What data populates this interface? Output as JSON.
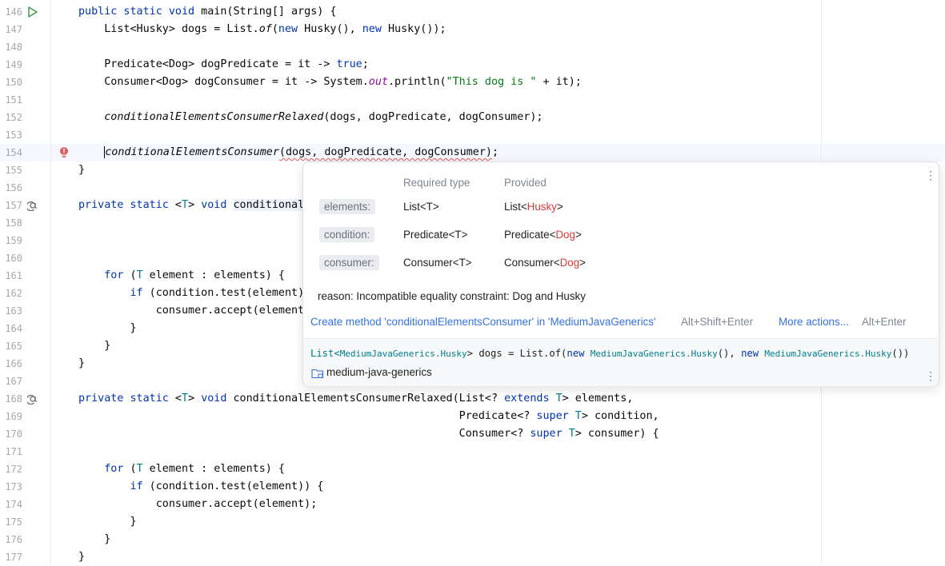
{
  "editor": {
    "lines": [
      {
        "n": "146",
        "html": "<span class=\"kw\">public static void</span> main(String[] args) {"
      },
      {
        "n": "147",
        "html": "    List&lt;Husky&gt; dogs = List.<span class=\"it\">of</span>(<span class=\"kw\">new</span> Husky(), <span class=\"kw\">new</span> Husky());"
      },
      {
        "n": "148",
        "html": ""
      },
      {
        "n": "149",
        "html": "    Predicate&lt;Dog&gt; dogPredicate = it -&gt; <span class=\"kw\">true</span>;"
      },
      {
        "n": "150",
        "html": "    Consumer&lt;Dog&gt; dogConsumer = it -&gt; System.<span class=\"it\" style=\"color:#871094\">out</span>.println(<span class=\"st\">\"This dog is \"</span> + it);"
      },
      {
        "n": "151",
        "html": ""
      },
      {
        "n": "152",
        "html": "    <span class=\"it\">conditionalElementsConsumerRelaxed</span>(dogs, dogPredicate, dogConsumer);"
      },
      {
        "n": "153",
        "html": ""
      },
      {
        "n": "154",
        "html": "    <span class=\"caret\"></span><span class=\"it\">conditionalElementsConsumer</span><span class=\"squig\">(dogs, dogPredicate, dogConsumer)</span>;"
      },
      {
        "n": "155",
        "html": "}"
      },
      {
        "n": "156",
        "html": ""
      },
      {
        "n": "157",
        "html": "<span class=\"kw\">private static</span> &lt;<span class=\"tp\">T</span>&gt; <span class=\"kw\">void</span> <span class=\"hl\">conditional</span>"
      },
      {
        "n": "158",
        "html": ""
      },
      {
        "n": "159",
        "html": ""
      },
      {
        "n": "160",
        "html": ""
      },
      {
        "n": "161",
        "html": "    <span class=\"kw\">for</span> (<span class=\"tp\">T</span> element : elements) {"
      },
      {
        "n": "162",
        "html": "        <span class=\"kw\">if</span> (condition.test(element)"
      },
      {
        "n": "163",
        "html": "            consumer.accept(element"
      },
      {
        "n": "164",
        "html": "        }"
      },
      {
        "n": "165",
        "html": "    }"
      },
      {
        "n": "166",
        "html": "}"
      },
      {
        "n": "167",
        "html": ""
      },
      {
        "n": "168",
        "html": "<span class=\"kw\">private static</span> &lt;<span class=\"tp\">T</span>&gt; <span class=\"kw\">void</span> conditionalElementsConsumerRelaxed(List&lt;? <span class=\"kw\">extends</span> <span class=\"tp\">T</span>&gt; elements,"
      },
      {
        "n": "169",
        "html": "                                                           Predicate&lt;? <span class=\"kw\">super</span> <span class=\"tp\">T</span>&gt; condition,"
      },
      {
        "n": "170",
        "html": "                                                           Consumer&lt;? <span class=\"kw\">super</span> <span class=\"tp\">T</span>&gt; consumer) {"
      },
      {
        "n": "171",
        "html": ""
      },
      {
        "n": "172",
        "html": "    <span class=\"kw\">for</span> (<span class=\"tp\">T</span> element : elements) {"
      },
      {
        "n": "173",
        "html": "        <span class=\"kw\">if</span> (condition.test(element)) {"
      },
      {
        "n": "174",
        "html": "            consumer.accept(element);"
      },
      {
        "n": "175",
        "html": "        }"
      },
      {
        "n": "176",
        "html": "    }"
      },
      {
        "n": "177",
        "html": "}"
      }
    ]
  },
  "popup": {
    "header_required": "Required type",
    "header_provided": "Provided",
    "rows": [
      {
        "param": "elements:",
        "required": "List<T>",
        "provided_prefix": "List<",
        "provided_type": "Husky",
        "provided_suffix": ">"
      },
      {
        "param": "condition:",
        "required": "Predicate<T>",
        "provided_prefix": "Predicate<",
        "provided_type": "Dog",
        "provided_suffix": ">"
      },
      {
        "param": "consumer:",
        "required": "Consumer<T>",
        "provided_prefix": "Consumer<",
        "provided_type": "Dog",
        "provided_suffix": ">"
      }
    ],
    "reason": "reason: Incompatible equality constraint: Dog and Husky",
    "action_create": "Create method 'conditionalElementsConsumer' in 'MediumJavaGenerics'",
    "action_create_shortcut": "Alt+Shift+Enter",
    "action_more": "More actions...",
    "action_more_shortcut": "Alt+Enter",
    "decl": {
      "p1": "List<",
      "c1": "MediumJavaGenerics.Husky",
      "p2": "> dogs = List.of(",
      "k1": "new",
      "c2": "MediumJavaGenerics.Husky",
      "p3": "(), ",
      "k2": "new",
      "c3": "MediumJavaGenerics.Husky",
      "p4": "())"
    },
    "module": "medium-java-generics",
    "menu_glyph": "⋮"
  }
}
